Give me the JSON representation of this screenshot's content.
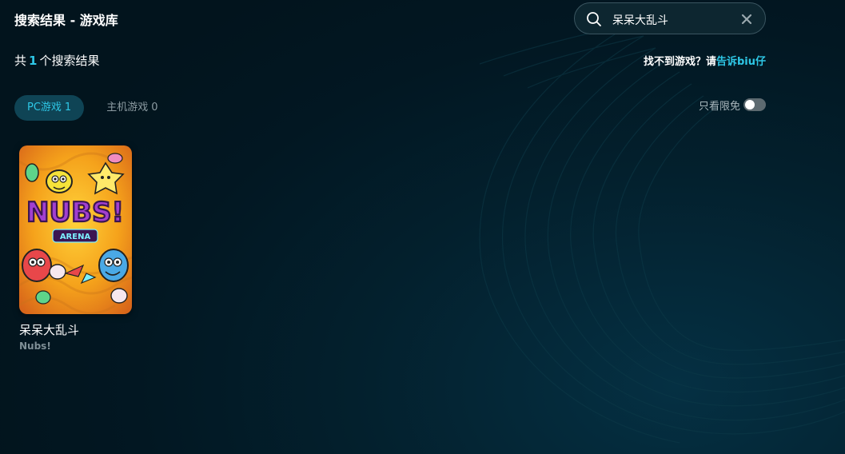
{
  "header": {
    "title": "搜索结果 - 游戏库"
  },
  "search": {
    "value": "呆呆大乱斗",
    "search_icon": "search-icon",
    "clear_icon": "close-icon"
  },
  "summary": {
    "prefix": "共",
    "count": "1",
    "suffix": "个搜索结果"
  },
  "feedback": {
    "text": "找不到游戏？请",
    "link": "告诉biu仔"
  },
  "tabs": [
    {
      "label": "PC游戏",
      "count": "1",
      "active": true
    },
    {
      "label": "主机游戏",
      "count": "0",
      "active": false
    }
  ],
  "filter": {
    "free_only_label": "只看限免",
    "free_only_enabled": false
  },
  "results": [
    {
      "name": "呆呆大乱斗",
      "subname": "Nubs!",
      "cover_logo": "NUBS!",
      "cover_tagline": "ARENA"
    }
  ],
  "colors": {
    "accent": "#2ec7e6",
    "background": "#021a25",
    "tab_active_bg": "#0f4455"
  }
}
